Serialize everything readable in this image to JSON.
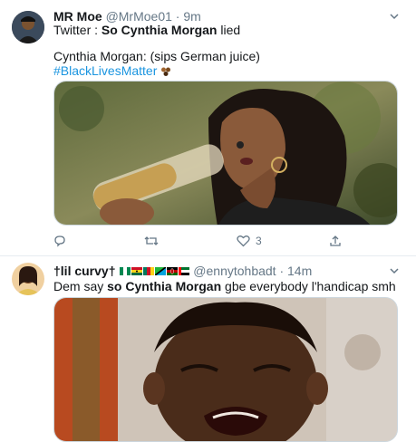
{
  "tweets": [
    {
      "name": "MR Moe",
      "handle": "@MrMoe01",
      "sep": "·",
      "time": "9m",
      "line1_prefix": "Twitter : ",
      "line1_bold": "So Cynthia Morgan",
      "line1_suffix": " lied",
      "line2": "Cynthia Morgan: (sips German juice)",
      "hashtag": "#BlackLivesMatter",
      "actions": {
        "reply_count": "",
        "retweet_count": "",
        "like_count": "3"
      }
    },
    {
      "name": "†lil curvy†",
      "handle": "@ennytohbadt",
      "sep": "·",
      "time": "14m",
      "text_prefix": "Dem say ",
      "text_bold": "so Cynthia Morgan",
      "text_suffix": " gbe everybody l'handicap smh"
    }
  ],
  "colors": {
    "link": "#1b95e0",
    "secondary": "#657786",
    "divider": "#e6ecf0"
  },
  "icons": [
    "chevron-down-icon",
    "reply-icon",
    "retweet-icon",
    "like-icon",
    "share-icon"
  ]
}
